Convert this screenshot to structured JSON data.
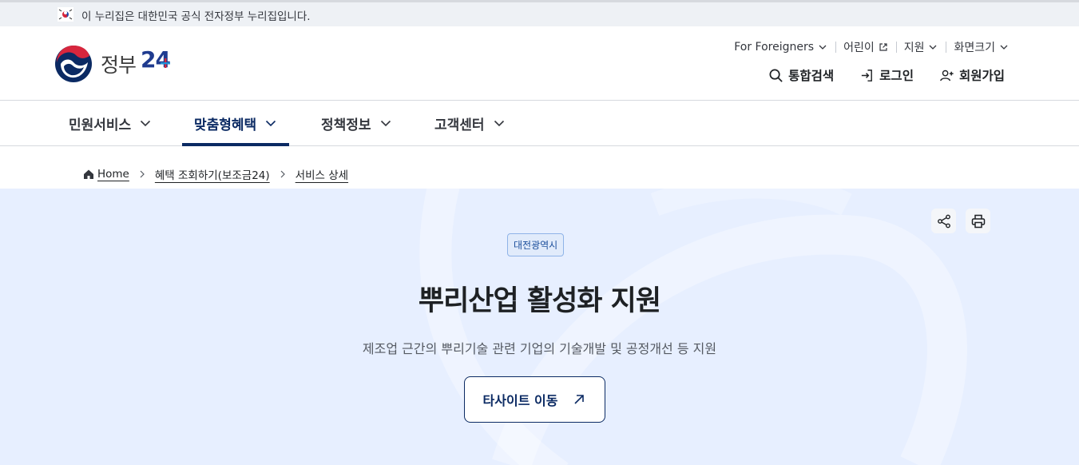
{
  "gov_banner": {
    "text": "이 누리집은 대한민국 공식 전자정부 누리집입니다."
  },
  "logo": {
    "name": "정부",
    "number": "24"
  },
  "utility": {
    "foreigners": "For Foreigners",
    "kids": "어린이",
    "support": "지원",
    "screen_size": "화면크기"
  },
  "actions": {
    "search": "통합검색",
    "login": "로그인",
    "signup": "회원가입"
  },
  "gnb": [
    {
      "label": "민원서비스",
      "active": false
    },
    {
      "label": "맞춤형혜택",
      "active": true
    },
    {
      "label": "정책정보",
      "active": false
    },
    {
      "label": "고객센터",
      "active": false
    }
  ],
  "breadcrumb": [
    "Home",
    "혜택 조회하기(보조금24)",
    "서비스 상세"
  ],
  "hero": {
    "region_badge": "대전광역시",
    "title": "뿌리산업 활성화 지원",
    "description": "제조업 근간의 뿌리기술 관련 기업의 기술개발 및 공정개선 등 지원",
    "site_button": "타사이트 이동"
  },
  "colors": {
    "navy": "#0b2a63",
    "hero_bg": "#e7efff",
    "banner_bg": "#eef1f5"
  },
  "icons": [
    "korea-flag-icon",
    "chevron-down-icon",
    "external-link-icon",
    "search-icon",
    "login-icon",
    "user-plus-icon",
    "home-icon",
    "chevron-right-icon",
    "share-icon",
    "print-icon",
    "arrow-up-right-icon"
  ]
}
